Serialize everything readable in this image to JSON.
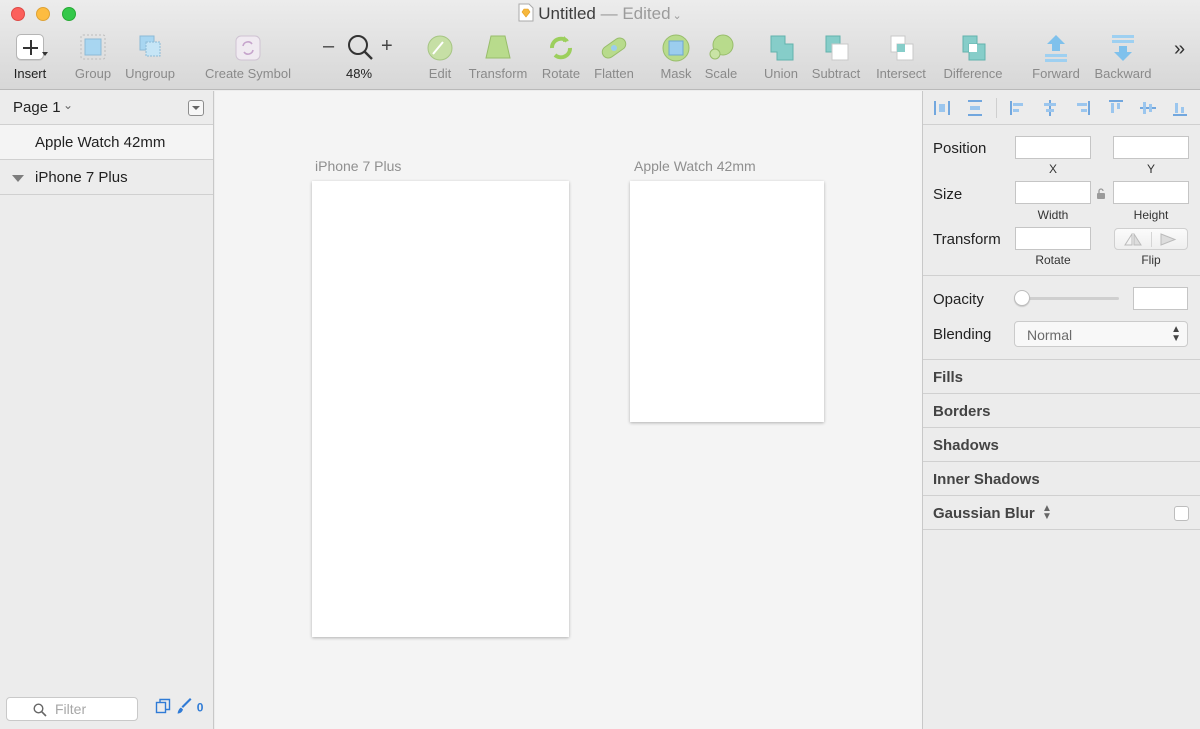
{
  "window": {
    "title": "Untitled",
    "separator": "—",
    "edited": "Edited"
  },
  "toolbar": {
    "insert": "Insert",
    "group": "Group",
    "ungroup": "Ungroup",
    "create_symbol": "Create Symbol",
    "zoom_minus": "–",
    "zoom_plus": "+",
    "zoom_level": "48%",
    "edit": "Edit",
    "transform": "Transform",
    "rotate": "Rotate",
    "flatten": "Flatten",
    "mask": "Mask",
    "scale": "Scale",
    "union": "Union",
    "subtract": "Subtract",
    "intersect": "Intersect",
    "difference": "Difference",
    "forward": "Forward",
    "backward": "Backward",
    "overflow": "»"
  },
  "sidebar": {
    "page_name": "Page 1",
    "layers": [
      {
        "label": "Apple Watch 42mm"
      },
      {
        "label": "iPhone 7 Plus"
      }
    ],
    "filter_placeholder": "Filter",
    "edit_count": "0"
  },
  "canvas": {
    "artboards": [
      {
        "label": "iPhone 7 Plus"
      },
      {
        "label": "Apple Watch 42mm"
      }
    ]
  },
  "inspector": {
    "position_label": "Position",
    "x_label": "X",
    "y_label": "Y",
    "size_label": "Size",
    "width_label": "Width",
    "height_label": "Height",
    "transform_label": "Transform",
    "rotate_label": "Rotate",
    "flip_label": "Flip",
    "opacity_label": "Opacity",
    "opacity_value": 0,
    "blending_label": "Blending",
    "blending_value": "Normal",
    "sections": {
      "fills": "Fills",
      "borders": "Borders",
      "shadows": "Shadows",
      "inner_shadows": "Inner Shadows",
      "gaussian_blur": "Gaussian Blur"
    }
  },
  "colors": {
    "accent": "#2f7bd6",
    "tool_green": "#9ccf5d",
    "tool_teal": "#86cdc9",
    "tool_blue": "#9bcdee",
    "close": "#fc605c",
    "minimize": "#fdbc40",
    "maximize": "#34c84a"
  }
}
